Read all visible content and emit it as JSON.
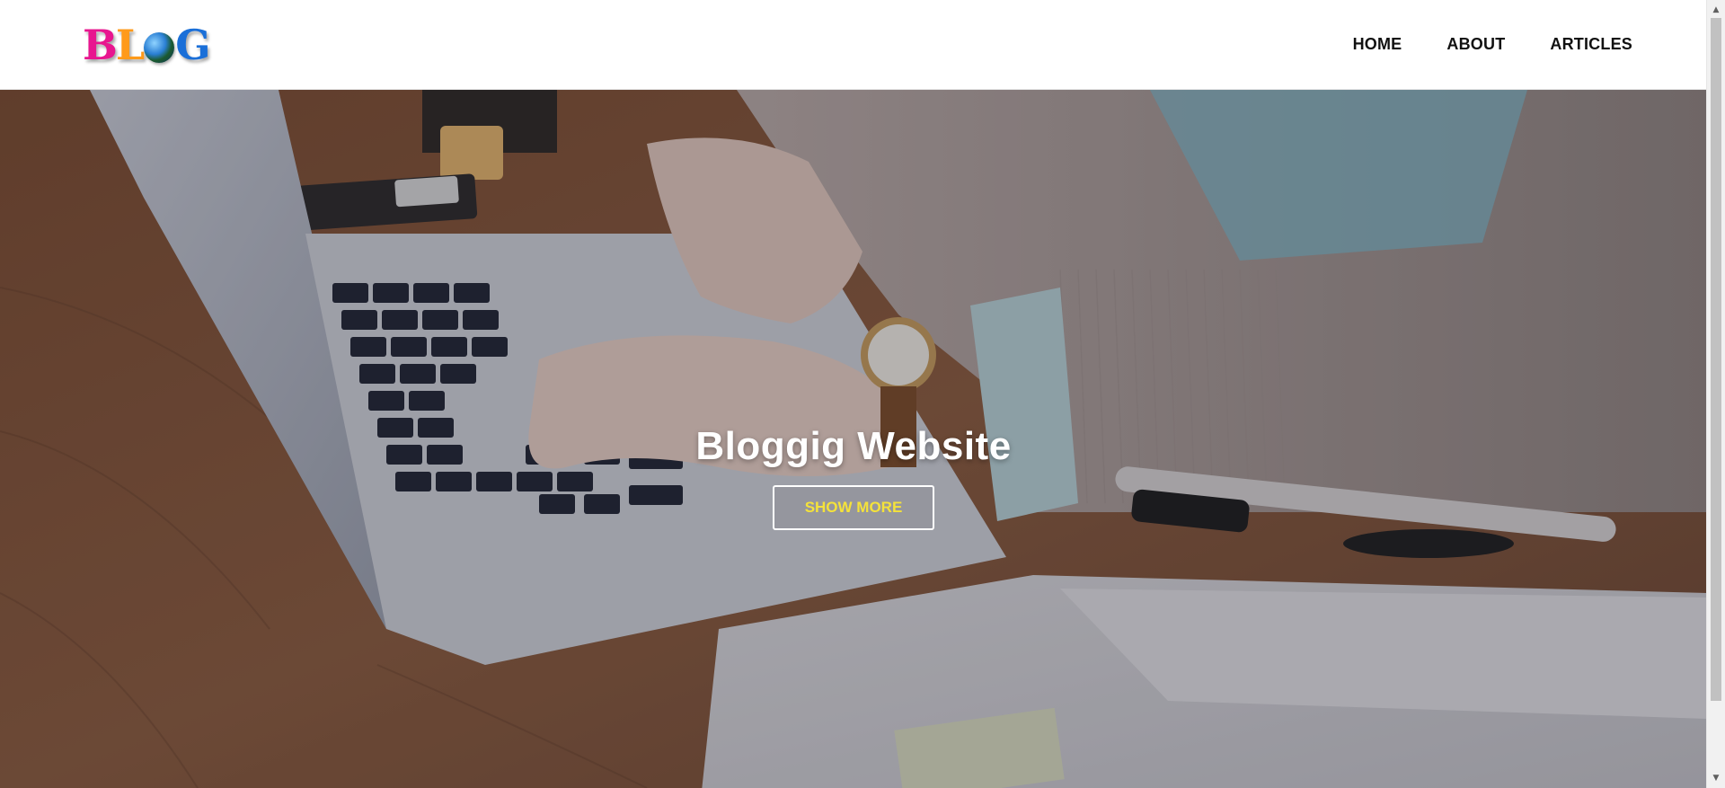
{
  "header": {
    "logo_text": "BLOG",
    "nav": [
      {
        "label": "HOME"
      },
      {
        "label": "ABOUT"
      },
      {
        "label": "ARTICLES"
      }
    ]
  },
  "hero": {
    "title": "Bloggig Website",
    "button_label": "SHOW MORE"
  },
  "colors": {
    "button_text": "#f4e23a",
    "nav_text": "#111111",
    "header_bg": "#ffffff"
  },
  "scrollbar": {
    "up_icon": "triangle-up-icon",
    "down_icon": "triangle-down-icon"
  }
}
